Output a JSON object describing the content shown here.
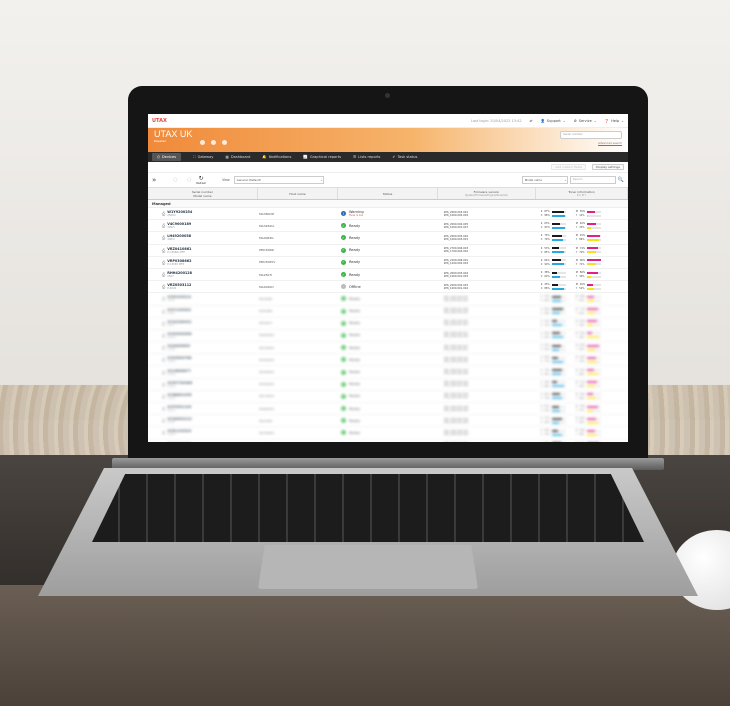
{
  "topbar": {
    "logo": "UTAX",
    "last_login": "Last login: 20/04/2022 13:42",
    "user": "Support",
    "service": "Service",
    "help": "Help"
  },
  "banner": {
    "tenant": "UTAX UK",
    "sub": "Reseller",
    "search_placeholder": "Serial number",
    "advanced": "Advanced search"
  },
  "nav": [
    {
      "label": "Devices",
      "icon": "printer-icon",
      "active": true
    },
    {
      "label": "Gateway",
      "icon": "gateway-icon",
      "active": false
    },
    {
      "label": "Dashboard",
      "icon": "dashboard-icon",
      "active": false
    },
    {
      "label": "Notifications",
      "icon": "bell-icon",
      "active": false
    },
    {
      "label": "Graphical reports",
      "icon": "chart-icon",
      "active": false
    },
    {
      "label": "Lists reports",
      "icon": "list-icon",
      "active": false
    },
    {
      "label": "Task status",
      "icon": "task-icon",
      "active": false
    }
  ],
  "subtools": {
    "add_fields": "Add custom fields",
    "display_settings": "Display settings"
  },
  "filter": {
    "refresh": "Refresh",
    "view_label": "View",
    "view_value": "General (Default)",
    "right_select": "Model name",
    "search_placeholder": "Search"
  },
  "columns": {
    "serial": "Serial number",
    "model": "Model name",
    "host": "Host name",
    "status": "Status",
    "firmware": "Firmware version",
    "firmware_sub": "(System/Firmware/Engine/Panel/etc)",
    "toner": "Toner information",
    "toner_sub": "K  C  M  Y"
  },
  "group_label": "Managed",
  "rows": [
    {
      "serial": "W1Y9200254",
      "model": "2508ci",
      "host": "MA360CIP",
      "status": "Warning",
      "status_sub": "Toner is low",
      "status_type": "warning",
      "fw1": "2P6_2000.003.001",
      "fw2": "2P6_1000.002.002",
      "toner": [
        {
          "c": "K",
          "v": "87%",
          "f": 0.87
        },
        {
          "c": "C",
          "v": "98%",
          "f": 0.98
        },
        {
          "c": "M",
          "v": "55%",
          "f": 0.55
        },
        {
          "c": "Y",
          "v": "12%",
          "f": 0.12
        }
      ]
    },
    {
      "serial": "V4C9000189",
      "model": "3262i",
      "host": "MA3262IA",
      "status": "Ready",
      "status_sub": "",
      "status_type": "ready",
      "fw1": "2P6_2000.002.005",
      "fw2": "2P6_1000.001.007",
      "toner": [
        {
          "c": "K",
          "v": "63%",
          "f": 0.63
        },
        {
          "c": "C",
          "v": "93%",
          "f": 0.93
        },
        {
          "c": "M",
          "v": "62%",
          "f": 0.62
        },
        {
          "c": "Y",
          "v": "32%",
          "f": 0.32
        }
      ]
    },
    {
      "serial": "LH49200058",
      "model": "4063i",
      "host": "MA4063IL",
      "status": "Ready",
      "status_sub": "",
      "status_type": "ready",
      "fw1": "2P6_2000.005.002",
      "fw2": "2P6_1000.003.001",
      "toner": [
        {
          "c": "K",
          "v": "75%",
          "f": 0.75
        },
        {
          "c": "C",
          "v": "79%",
          "f": 0.79
        },
        {
          "c": "M",
          "v": "91%",
          "f": 0.91
        },
        {
          "c": "Y",
          "v": "86%",
          "f": 0.86
        }
      ]
    },
    {
      "serial": "VRZ0410861",
      "model": "P-C3066i MFP",
      "host": "PMC3066I",
      "status": "Ready",
      "status_sub": "",
      "status_type": "ready",
      "fw1": "2P6_2700.006.003",
      "fw2": "2P6_1700.004.002",
      "toner": [
        {
          "c": "K",
          "v": "53%",
          "f": 0.53
        },
        {
          "c": "C",
          "v": "85%",
          "f": 0.85
        },
        {
          "c": "M",
          "v": "74%",
          "f": 0.74
        },
        {
          "c": "Y",
          "v": "70%",
          "f": 0.7
        }
      ]
    },
    {
      "serial": "VRP0308662",
      "model": "P-C3065 MFP",
      "host": "PMC3065V",
      "status": "Ready",
      "status_sub": "",
      "status_type": "ready",
      "fw1": "2P6_2100.006.001",
      "fw2": "2P6_1200.002.003",
      "toner": [
        {
          "c": "K",
          "v": "64%",
          "f": 0.64
        },
        {
          "c": "C",
          "v": "90%",
          "f": 0.9
        },
        {
          "c": "M",
          "v": "96%",
          "f": 0.96
        },
        {
          "c": "Y",
          "v": "71%",
          "f": 0.71
        }
      ]
    },
    {
      "serial": "RHH4200128",
      "model": "2507",
      "host": "MA2507I",
      "status": "Ready",
      "status_sub": "",
      "status_type": "ready",
      "fw1": "2P6_2000.003.004",
      "fw2": "2P6_1000.001.003",
      "toner": [
        {
          "c": "K",
          "v": "38%",
          "f": 0.38
        },
        {
          "c": "C",
          "v": "60%",
          "f": 0.6
        },
        {
          "c": "M",
          "v": "80%",
          "f": 0.8
        },
        {
          "c": "Y",
          "v": "30%",
          "f": 0.3
        }
      ]
    },
    {
      "serial": "VRZ0503112",
      "model": "P-4020",
      "host": "MA4020D",
      "status": "Offline",
      "status_sub": "",
      "status_type": "offline",
      "fw1": "2P6_2000.002.003",
      "fw2": "2P6_1000.001.004",
      "toner": [
        {
          "c": "K",
          "v": "45%",
          "f": 0.45
        },
        {
          "c": "C",
          "v": "88%",
          "f": 0.88
        },
        {
          "c": "M",
          "v": "40%",
          "f": 0.4
        },
        {
          "c": "Y",
          "v": "52%",
          "f": 0.52
        }
      ]
    },
    {
      "serial": "VCE9100213",
      "model": "3508i",
      "host": "MA3508I",
      "status": "Ready",
      "status_sub": "",
      "status_type": "ready",
      "fw1": "2P6_2000.004.001",
      "fw2": "2P6_1000.002.001",
      "toner": [
        {
          "c": "K",
          "v": "70%",
          "f": 0.7
        },
        {
          "c": "C",
          "v": "66%",
          "f": 0.66
        },
        {
          "c": "M",
          "v": "48%",
          "f": 0.48
        },
        {
          "c": "Y",
          "v": "55%",
          "f": 0.55
        }
      ]
    },
    {
      "serial": "VCF1100322",
      "model": "4008i",
      "host": "MA4008I",
      "status": "Ready",
      "status_sub": "",
      "status_type": "ready",
      "fw1": "2P6_2000.001.006",
      "fw2": "2P6_1000.003.002",
      "toner": [
        {
          "c": "K",
          "v": "82%",
          "f": 0.82
        },
        {
          "c": "C",
          "v": "58%",
          "f": 0.58
        },
        {
          "c": "M",
          "v": "77%",
          "f": 0.77
        },
        {
          "c": "Y",
          "v": "63%",
          "f": 0.63
        }
      ]
    },
    {
      "serial": "VCG2200431",
      "model": "5007i",
      "host": "MA5007I",
      "status": "Ready",
      "status_sub": "",
      "status_type": "ready",
      "fw1": "2P6_2000.003.002",
      "fw2": "2P6_1000.001.001",
      "toner": [
        {
          "c": "K",
          "v": "41%",
          "f": 0.41
        },
        {
          "c": "C",
          "v": "72%",
          "f": 0.72
        },
        {
          "c": "M",
          "v": "69%",
          "f": 0.69
        },
        {
          "c": "Y",
          "v": "44%",
          "f": 0.44
        }
      ]
    },
    {
      "serial": "VCH3300540",
      "model": "6008ci",
      "host": "MA6008CI",
      "status": "Ready",
      "status_sub": "",
      "status_type": "ready",
      "fw1": "2P6_2000.005.001",
      "fw2": "2P6_1000.002.004",
      "toner": [
        {
          "c": "K",
          "v": "59%",
          "f": 0.59
        },
        {
          "c": "C",
          "v": "81%",
          "f": 0.81
        },
        {
          "c": "M",
          "v": "35%",
          "f": 0.35
        },
        {
          "c": "Y",
          "v": "90%",
          "f": 0.9
        }
      ]
    },
    {
      "serial": "VCJ4400659",
      "model": "2506ci",
      "host": "MA2506CI",
      "status": "Ready",
      "status_sub": "",
      "status_type": "ready",
      "fw1": "2P6_2000.002.007",
      "fw2": "2P6_1000.004.001",
      "toner": [
        {
          "c": "K",
          "v": "67%",
          "f": 0.67
        },
        {
          "c": "C",
          "v": "54%",
          "f": 0.54
        },
        {
          "c": "M",
          "v": "83%",
          "f": 0.83
        },
        {
          "c": "Y",
          "v": "62%",
          "f": 0.62
        }
      ]
    },
    {
      "serial": "VCK5500768",
      "model": "3206ci",
      "host": "MA3206CI",
      "status": "Ready",
      "status_sub": "",
      "status_type": "ready",
      "fw1": "2P6_2000.006.002",
      "fw2": "2P6_1000.003.005",
      "toner": [
        {
          "c": "K",
          "v": "48%",
          "f": 0.48
        },
        {
          "c": "C",
          "v": "77%",
          "f": 0.77
        },
        {
          "c": "M",
          "v": "60%",
          "f": 0.6
        },
        {
          "c": "Y",
          "v": "74%",
          "f": 0.74
        }
      ]
    },
    {
      "serial": "VCL6600877",
      "model": "4006ci",
      "host": "MA4006CI",
      "status": "Ready",
      "status_sub": "",
      "status_type": "ready",
      "fw1": "2P6_2000.001.003",
      "fw2": "2P6_1000.002.006",
      "toner": [
        {
          "c": "K",
          "v": "73%",
          "f": 0.73
        },
        {
          "c": "C",
          "v": "64%",
          "f": 0.64
        },
        {
          "c": "M",
          "v": "52%",
          "f": 0.52
        },
        {
          "c": "Y",
          "v": "80%",
          "f": 0.8
        }
      ]
    },
    {
      "serial": "VCM7700986",
      "model": "5006ci",
      "host": "MA5006CI",
      "status": "Ready",
      "status_sub": "",
      "status_type": "ready",
      "fw1": "2P6_2000.004.004",
      "fw2": "2P6_1000.001.008",
      "toner": [
        {
          "c": "K",
          "v": "36%",
          "f": 0.36
        },
        {
          "c": "C",
          "v": "86%",
          "f": 0.86
        },
        {
          "c": "M",
          "v": "71%",
          "f": 0.71
        },
        {
          "c": "Y",
          "v": "58%",
          "f": 0.58
        }
      ]
    },
    {
      "serial": "VCN8801095",
      "model": "7006ci",
      "host": "MA7006CI",
      "status": "Ready",
      "status_sub": "",
      "status_type": "ready",
      "fw1": "2P6_2000.003.009",
      "fw2": "2P6_1000.004.003",
      "toner": [
        {
          "c": "K",
          "v": "62%",
          "f": 0.62
        },
        {
          "c": "C",
          "v": "70%",
          "f": 0.7
        },
        {
          "c": "M",
          "v": "44%",
          "f": 0.44
        },
        {
          "c": "Y",
          "v": "66%",
          "f": 0.66
        }
      ]
    },
    {
      "serial": "VCP9901104",
      "model": "8006ci",
      "host": "MA8006CI",
      "status": "Ready",
      "status_sub": "",
      "status_type": "ready",
      "fw1": "2P6_2000.002.008",
      "fw2": "2P6_1000.003.006",
      "toner": [
        {
          "c": "K",
          "v": "55%",
          "f": 0.55
        },
        {
          "c": "C",
          "v": "61%",
          "f": 0.61
        },
        {
          "c": "M",
          "v": "79%",
          "f": 0.79
        },
        {
          "c": "Y",
          "v": "47%",
          "f": 0.47
        }
      ]
    },
    {
      "serial": "VCQ0002213",
      "model": "2508i",
      "host": "MA2508I",
      "status": "Ready",
      "status_sub": "",
      "status_type": "ready",
      "fw1": "2P6_2000.005.006",
      "fw2": "2P6_1000.001.009",
      "toner": [
        {
          "c": "K",
          "v": "77%",
          "f": 0.77
        },
        {
          "c": "C",
          "v": "50%",
          "f": 0.5
        },
        {
          "c": "M",
          "v": "66%",
          "f": 0.66
        },
        {
          "c": "Y",
          "v": "83%",
          "f": 0.83
        }
      ]
    },
    {
      "serial": "VCR1103322",
      "model": "3508ci",
      "host": "MA3508CI",
      "status": "Ready",
      "status_sub": "",
      "status_type": "ready",
      "fw1": "2P6_2000.006.005",
      "fw2": "2P6_1000.002.009",
      "toner": [
        {
          "c": "K",
          "v": "44%",
          "f": 0.44
        },
        {
          "c": "C",
          "v": "74%",
          "f": 0.74
        },
        {
          "c": "M",
          "v": "58%",
          "f": 0.58
        },
        {
          "c": "Y",
          "v": "69%",
          "f": 0.69
        }
      ]
    },
    {
      "serial": "VCS2204431",
      "model": "4508ci",
      "host": "MA4508CI",
      "status": "Ready",
      "status_sub": "",
      "status_type": "ready",
      "fw1": "2P6_2000.001.009",
      "fw2": "2P6_1000.004.007",
      "toner": [
        {
          "c": "K",
          "v": "69%",
          "f": 0.69
        },
        {
          "c": "C",
          "v": "57%",
          "f": 0.57
        },
        {
          "c": "M",
          "v": "88%",
          "f": 0.88
        },
        {
          "c": "Y",
          "v": "51%",
          "f": 0.51
        }
      ]
    }
  ],
  "colors": {
    "K": "#1a1a1a",
    "C": "#27a9e1",
    "M": "#e0218a",
    "Y": "#f7e017",
    "ready": "#3bb54a",
    "warning": "#2b6fb6",
    "offline": "#bbbbbb",
    "accent": "#f08a3a"
  }
}
